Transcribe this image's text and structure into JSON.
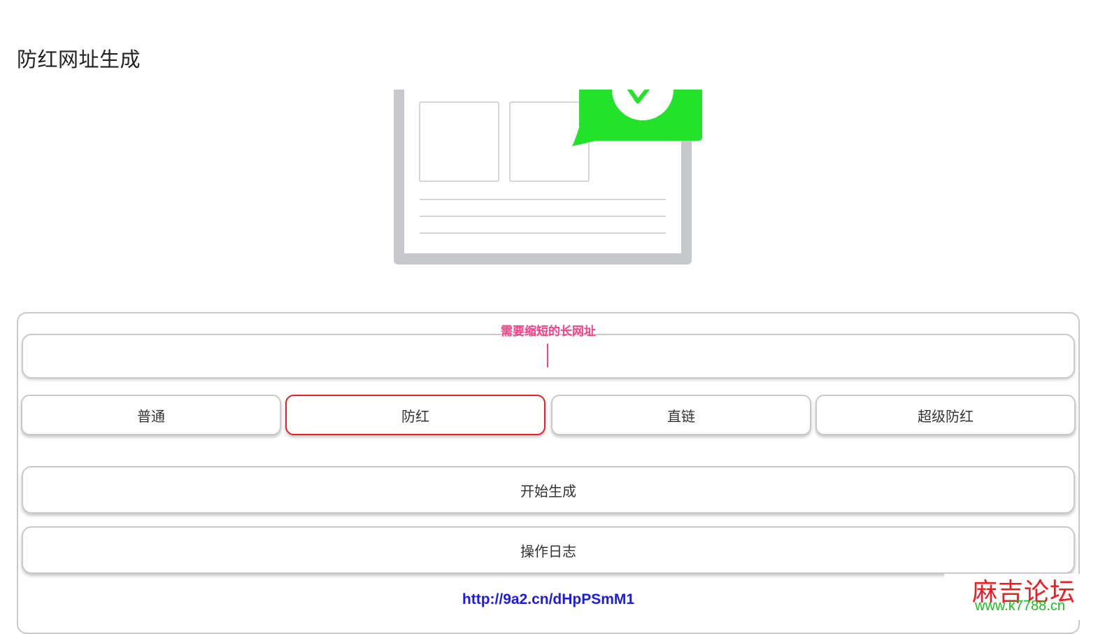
{
  "page": {
    "title": "防红网址生成"
  },
  "form": {
    "url_label": "需要缩短的长网址",
    "url_value": "",
    "modes": [
      {
        "label": "普通",
        "active": false
      },
      {
        "label": "防红",
        "active": true
      },
      {
        "label": "直链",
        "active": false
      },
      {
        "label": "超级防红",
        "active": false
      }
    ],
    "generate_label": "开始生成",
    "log_label": "操作日志"
  },
  "result": {
    "short_url": "http://9a2.cn/dHpPSmM1"
  },
  "watermark": {
    "title": "麻吉论坛",
    "url": "www.k7788.cn"
  },
  "colors": {
    "accent_pink": "#ff3f88",
    "active_border": "#ee1c25",
    "link_blue": "#1b1bf0",
    "illustration_green": "#22e22a",
    "illustration_gray": "#c7c8cc"
  }
}
